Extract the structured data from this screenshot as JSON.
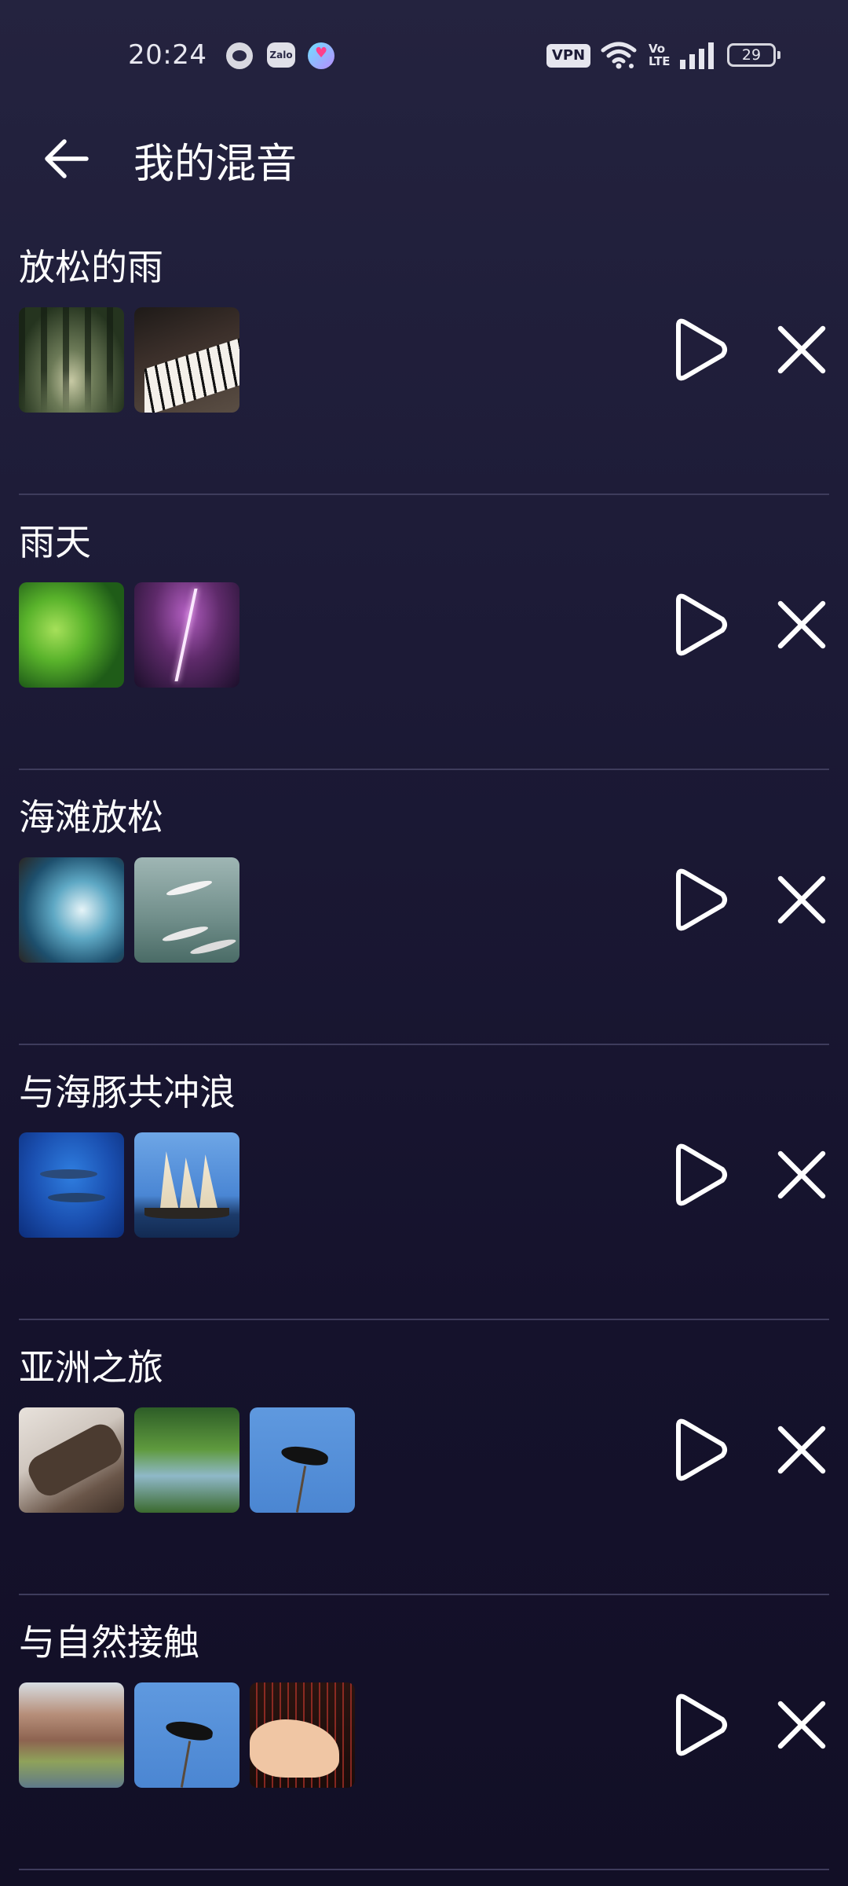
{
  "status_bar": {
    "time": "20:24",
    "notification_icons": [
      "cat-app-icon",
      "zalo-icon",
      "heart-app-icon"
    ],
    "zalo_label": "Zalo",
    "vpn_label": "VPN",
    "volte_label_top": "Vo",
    "volte_label_bottom": "LTE",
    "battery_level": "29"
  },
  "header": {
    "back_icon": "arrow-left-icon",
    "title": "我的混音"
  },
  "mixes": [
    {
      "name": "放松的雨",
      "thumbnails": [
        "forest-path",
        "piano-keys"
      ]
    },
    {
      "name": "雨天",
      "thumbnails": [
        "green-leaves-rain",
        "purple-lightning"
      ]
    },
    {
      "name": "海滩放松",
      "thumbnails": [
        "crashing-waves",
        "seagulls"
      ]
    },
    {
      "name": "与海豚共冲浪",
      "thumbnails": [
        "dolphins",
        "sailing-ship"
      ]
    },
    {
      "name": "亚洲之旅",
      "thumbnails": [
        "zither",
        "forest-stream",
        "blackbird"
      ]
    },
    {
      "name": "与自然接触",
      "thumbnails": [
        "canyon-river",
        "blackbird",
        "harp-hands"
      ]
    }
  ],
  "actions": {
    "play_icon": "play-icon",
    "remove_icon": "close-icon"
  },
  "colors": {
    "background_top": "#24233f",
    "background_bottom": "#120f26",
    "divider": "#3e3c5c",
    "text": "#ffffff"
  }
}
